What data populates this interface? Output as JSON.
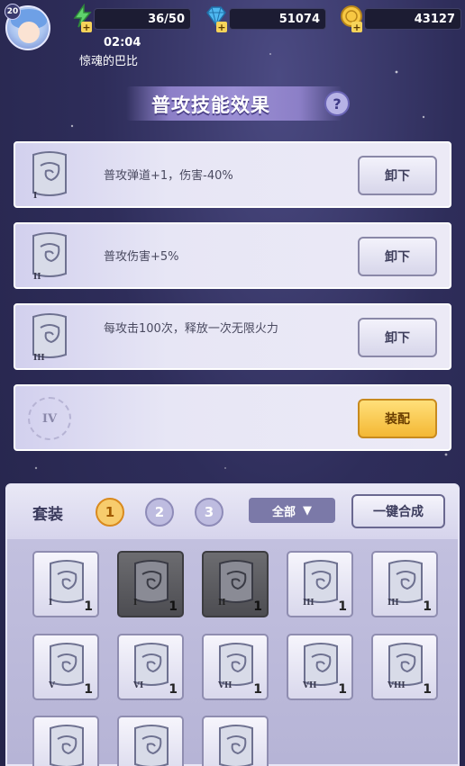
{
  "player": {
    "level": "20",
    "timer": "02:04",
    "name": "惊魂的巴比"
  },
  "resources": {
    "energy": "36/50",
    "gems": "51074",
    "coins": "43127"
  },
  "title": "普攻技能效果",
  "help_label": "?",
  "skills": [
    {
      "numeral": "I",
      "text": "普攻弹道+1，伤害-40%",
      "button": "卸下"
    },
    {
      "numeral": "II",
      "text": "普攻伤害+5%",
      "button": "卸下"
    },
    {
      "numeral": "III",
      "text": "每攻击100次，释放一次无限火力",
      "button": "卸下"
    },
    {
      "numeral": "IV",
      "text": "",
      "button": "装配"
    }
  ],
  "panel": {
    "set_label": "套装",
    "tabs": [
      "1",
      "2",
      "3"
    ],
    "filter": "全部",
    "merge_button": "一键合成"
  },
  "items": [
    {
      "numeral": "I",
      "count": "1"
    },
    {
      "numeral": "I",
      "count": "1"
    },
    {
      "numeral": "II",
      "count": "1"
    },
    {
      "numeral": "III",
      "count": "1"
    },
    {
      "numeral": "III",
      "count": "1"
    },
    {
      "numeral": "V",
      "count": "1"
    },
    {
      "numeral": "VI",
      "count": "1"
    },
    {
      "numeral": "VII",
      "count": "1"
    },
    {
      "numeral": "VII",
      "count": "1"
    },
    {
      "numeral": "VIII",
      "count": "1"
    },
    {
      "numeral": "",
      "count": ""
    },
    {
      "numeral": "",
      "count": ""
    },
    {
      "numeral": "",
      "count": ""
    }
  ]
}
